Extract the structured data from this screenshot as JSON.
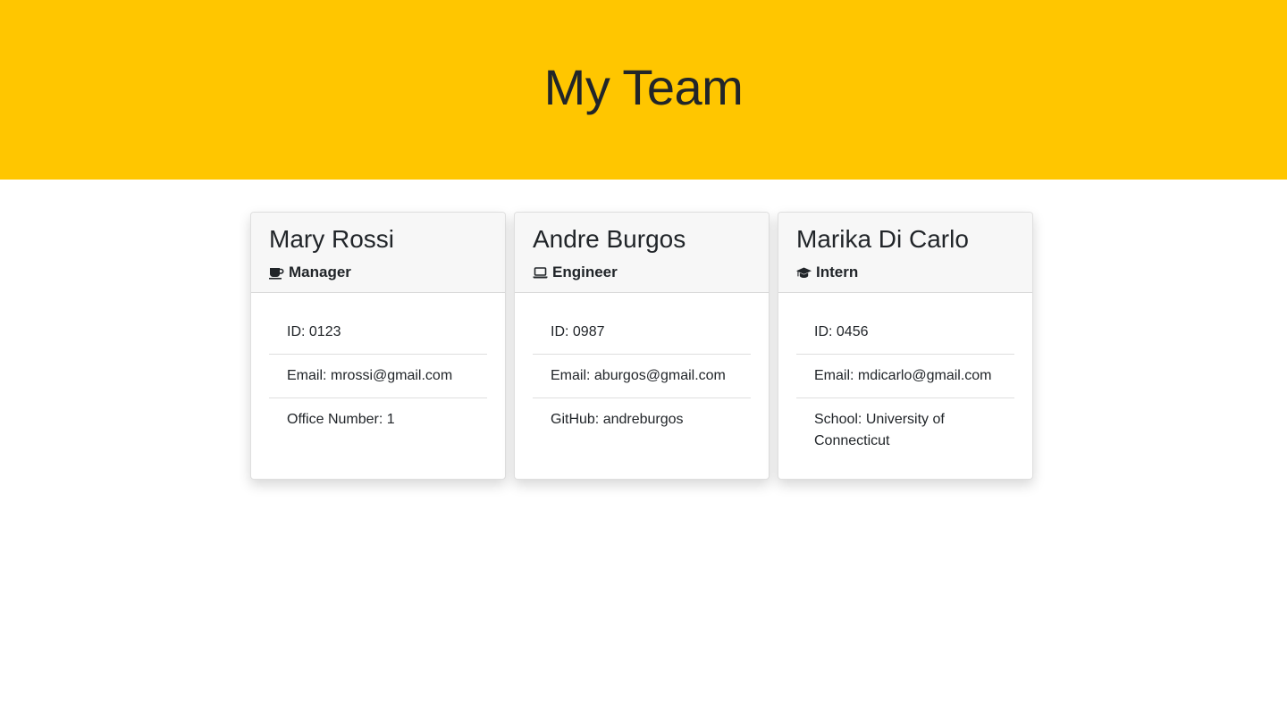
{
  "header": {
    "title": "My Team"
  },
  "team": [
    {
      "name": "Mary Rossi",
      "role": "Manager",
      "icon": "coffee-icon",
      "id_text": "ID: 0123",
      "email_text": "Email: mrossi@gmail.com",
      "extra_text": "Office Number: 1"
    },
    {
      "name": "Andre Burgos",
      "role": "Engineer",
      "icon": "laptop-icon",
      "id_text": "ID: 0987",
      "email_text": "Email: aburgos@gmail.com",
      "extra_text": "GitHub: andreburgos"
    },
    {
      "name": "Marika Di Carlo",
      "role": "Intern",
      "icon": "graduation-cap-icon",
      "id_text": "ID: 0456",
      "email_text": "Email: mdicarlo@gmail.com",
      "extra_text": "School: University of Connecticut"
    }
  ],
  "colors": {
    "banner": "#ffc600",
    "text": "#212529"
  }
}
